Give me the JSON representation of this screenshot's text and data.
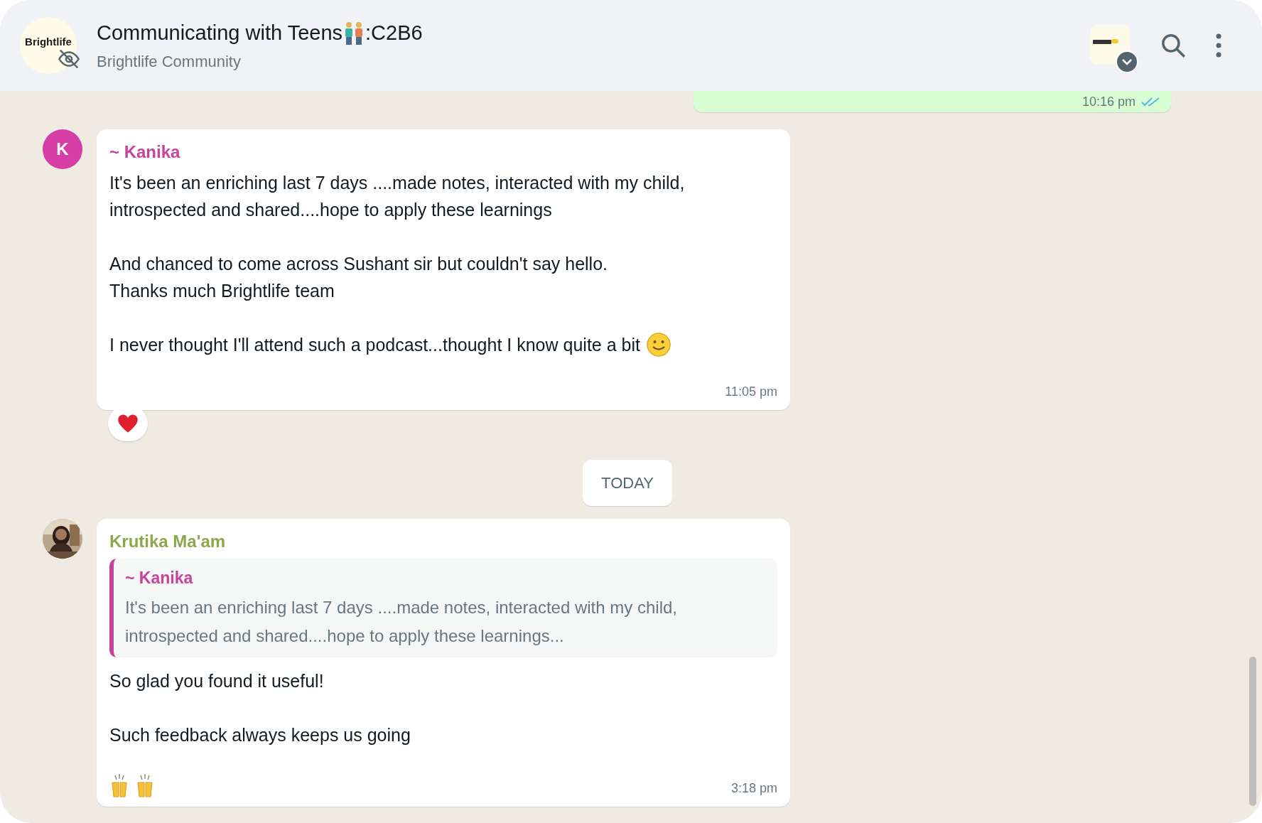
{
  "header": {
    "logo_text": "Brightlife",
    "title_parts": [
      "Communicating with Teens",
      ":C2B6"
    ],
    "subtitle": "Brightlife Community",
    "muted": true
  },
  "messages": [
    {
      "kind": "outgoing",
      "time": "10:16 pm",
      "read": true
    },
    {
      "kind": "incoming",
      "sender": "~ Kanika",
      "color": "#c7449c",
      "avatar": {
        "kind": "initial",
        "letter": "K",
        "color": "#d63ea6"
      },
      "paragraphs": [
        "It's been an enriching last 7 days ....made notes, interacted with my child,\nintrospected and shared....hope to apply these learnings",
        "And chanced to come across Sushant sir but couldn't say hello.\nThanks much Brightlife team",
        "I never thought I'll attend such a podcast...thought I know quite a bit"
      ],
      "trailing": {
        "kind": "smile"
      },
      "time": "11:05 pm",
      "reaction": {
        "kind": "heart"
      }
    },
    {
      "kind": "date",
      "label": "TODAY"
    },
    {
      "kind": "incoming",
      "sender": "Krutika Ma'am",
      "color": "#8ba84b",
      "avatar": {
        "kind": "picture"
      },
      "quote": {
        "sender": "~ Kanika",
        "text": "It's been an enriching last 7 days ....made notes, interacted with my child,\nintrospected and shared....hope to apply these learnings..."
      },
      "paragraphs": [
        "So glad you found it useful!",
        "Such feedback always keeps us going"
      ],
      "trailing": {
        "kind": "hands"
      },
      "time": "3:18 pm"
    }
  ]
}
